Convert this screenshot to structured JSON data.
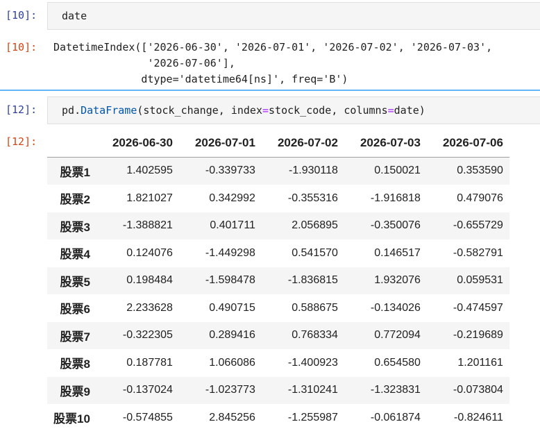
{
  "cells": [
    {
      "prompt": "[10]:",
      "code": "date",
      "output_prompt": "[10]:",
      "output_lines": [
        "DatetimeIndex(['2026-06-30', '2026-07-01', '2026-07-02', '2026-07-03',",
        "               '2026-07-06'],",
        "              dtype='datetime64[ns]', freq='B')"
      ]
    },
    {
      "prompt": "[12]:",
      "code_parts": {
        "mod": "pd",
        "dot": ".",
        "attr": "DataFrame",
        "arg1": "(stock_change, index",
        "eq1": "=",
        "arg2": "stock_code, columns",
        "eq2": "=",
        "arg3": "date)"
      },
      "output_prompt": "[12]:"
    }
  ],
  "dataframe": {
    "columns": [
      "2026-06-30",
      "2026-07-01",
      "2026-07-02",
      "2026-07-03",
      "2026-07-06"
    ],
    "rows": [
      {
        "index": "股票1",
        "values": [
          "1.402595",
          "-0.339733",
          "-1.930118",
          "0.150021",
          "0.353590"
        ]
      },
      {
        "index": "股票2",
        "values": [
          "1.821027",
          "0.342992",
          "-0.355316",
          "-1.916818",
          "0.479076"
        ]
      },
      {
        "index": "股票3",
        "values": [
          "-1.388821",
          "0.401711",
          "2.056895",
          "-0.350076",
          "-0.655729"
        ]
      },
      {
        "index": "股票4",
        "values": [
          "0.124076",
          "-1.449298",
          "0.541570",
          "0.146517",
          "-0.582791"
        ]
      },
      {
        "index": "股票5",
        "values": [
          "0.198484",
          "-1.598478",
          "-1.836815",
          "1.932076",
          "0.059531"
        ]
      },
      {
        "index": "股票6",
        "values": [
          "2.233628",
          "0.490715",
          "0.588675",
          "-0.134026",
          "-0.474597"
        ]
      },
      {
        "index": "股票7",
        "values": [
          "-0.322305",
          "0.289416",
          "0.768334",
          "0.772094",
          "-0.219689"
        ]
      },
      {
        "index": "股票8",
        "values": [
          "0.187781",
          "1.066086",
          "-1.400923",
          "0.654580",
          "1.201161"
        ]
      },
      {
        "index": "股票9",
        "values": [
          "-0.137024",
          "-1.023773",
          "-1.310241",
          "-1.323831",
          "-0.073804"
        ]
      },
      {
        "index": "股票10",
        "values": [
          "-0.574855",
          "2.845256",
          "-1.255987",
          "-0.061874",
          "-0.824611"
        ]
      }
    ]
  },
  "colors": {
    "input_prompt": "#303f9f",
    "output_prompt": "#d84315",
    "active_cell_border": "#64b5f6"
  }
}
